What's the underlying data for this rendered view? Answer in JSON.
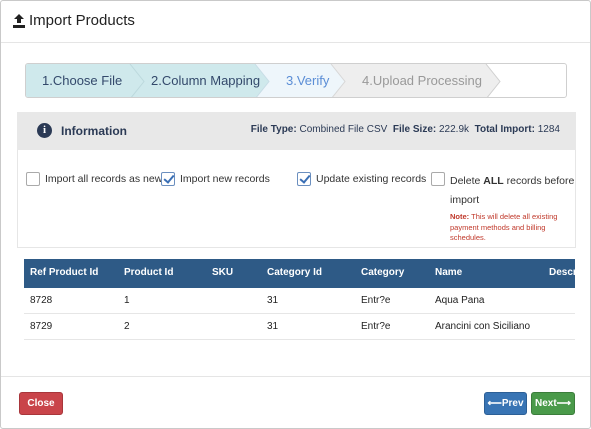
{
  "header": {
    "icon": "upload-icon",
    "title": "Import Products"
  },
  "wizard": {
    "steps": [
      {
        "label": "1.Choose File",
        "state": "done"
      },
      {
        "label": "2.Column Mapping",
        "state": "done"
      },
      {
        "label": "3.Verify",
        "state": "active"
      },
      {
        "label": "4.Upload Processing",
        "state": "pending"
      }
    ],
    "colors": {
      "done": "#cfe9ec",
      "active": "#eef6fb",
      "pending": "#eeeeee"
    }
  },
  "info": {
    "icon": "info-circle-icon",
    "title": "Information",
    "file_type_label": "File Type:",
    "file_type": "Combined File CSV",
    "file_size_label": "File Size:",
    "file_size": "222.9k",
    "total_import_label": "Total Import:",
    "total_import": "1284"
  },
  "options": {
    "import_all_new": {
      "label": "Import all records as new",
      "checked": false
    },
    "import_new": {
      "label": "Import new records",
      "checked": true
    },
    "update_existing": {
      "label": "Update existing records",
      "checked": true
    },
    "delete_all": {
      "checked": false,
      "label_prefix": "Delete ",
      "label_bold": "ALL",
      "label_suffix": " records before import",
      "note_bold": "Note:",
      "note_text": " This will delete all existing payment methods and billing schedules."
    }
  },
  "table": {
    "columns": [
      "Ref Product Id",
      "Product Id",
      "SKU",
      "Category Id",
      "Category",
      "Name",
      "Descr"
    ],
    "rows": [
      [
        "8728",
        "1",
        "",
        "31",
        "Entr?e",
        "Aqua Pana",
        ""
      ],
      [
        "8729",
        "2",
        "",
        "31",
        "Entr?e",
        "Arancini con Siciliano",
        ""
      ]
    ],
    "header_color": "#2e5a86"
  },
  "footer": {
    "close_label": "Close",
    "prev_label": "Prev",
    "next_label": "Next"
  }
}
